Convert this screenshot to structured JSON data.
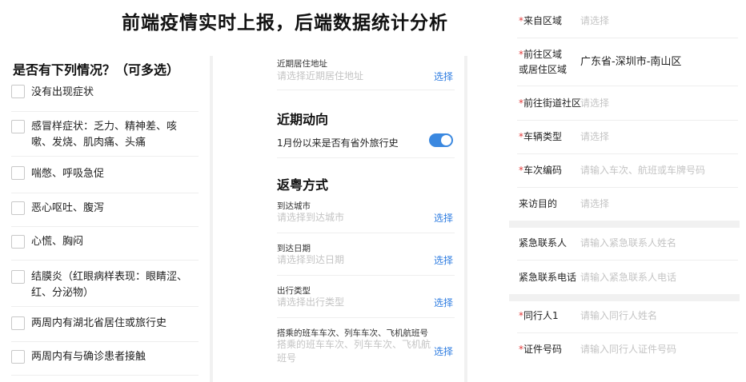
{
  "page_title": "前端疫情实时上报，后端数据统计分析",
  "symptoms": {
    "heading": "是否有下列情况？（可多选）",
    "options": [
      {
        "label": "没有出现症状",
        "checked": false
      },
      {
        "label": "感冒样症状：乏力、精神差、咳嗽、发烧、肌肉痛、头痛",
        "checked": false
      },
      {
        "label": "喘憋、呼吸急促",
        "checked": false
      },
      {
        "label": "恶心呕吐、腹泻",
        "checked": false
      },
      {
        "label": "心慌、胸闷",
        "checked": false
      },
      {
        "label": "结膜炎（红眼病样表现：眼睛涩、红、分泌物）",
        "checked": false
      },
      {
        "label": "两周内有湖北省居住或旅行史",
        "checked": false
      },
      {
        "label": "两周内有与确诊患者接触",
        "checked": false
      }
    ]
  },
  "travel": {
    "address": {
      "label": "近期居住地址",
      "placeholder": "请选择近期居住地址",
      "action": "选择"
    },
    "recent_heading": "近期动向",
    "outside_question": "1月份以来是否有省外旅行史",
    "outside_toggle_on": true,
    "return_heading": "返粤方式",
    "fields": [
      {
        "label": "到达城市",
        "placeholder": "请选择到达城市",
        "action": "选择"
      },
      {
        "label": "到达日期",
        "placeholder": "请选择到达日期",
        "action": "选择"
      },
      {
        "label": "出行类型",
        "placeholder": "请选择出行类型",
        "action": "选择"
      },
      {
        "label": "搭乘的班车车次、列车车次、飞机航班号",
        "placeholder_line1": "搭乘的班车车次、列车车次、飞机航",
        "placeholder_line2": "班号",
        "action": "选择"
      }
    ]
  },
  "personal": {
    "from_area": {
      "required": "*",
      "label": "来自区域",
      "placeholder": "请选择"
    },
    "dest_area": {
      "required": "*",
      "label_line1": "前往区域",
      "label_line2": "或居住区域",
      "value": "广东省-深圳市-南山区"
    },
    "dest_street": {
      "required": "*",
      "label": "前往街道社区",
      "placeholder": "请选择"
    },
    "vehicle_type": {
      "required": "*",
      "label": "车辆类型",
      "placeholder": "请选择"
    },
    "vehicle_code": {
      "required": "*",
      "label": "车次编码",
      "placeholder": "请输入车次、航班或车牌号码"
    },
    "visit_purpose": {
      "label": "来访目的",
      "placeholder": "请选择"
    },
    "emergency_name": {
      "label": "紧急联系人",
      "placeholder": "请输入紧急联系人姓名"
    },
    "emergency_phone": {
      "label": "紧急联系电话",
      "placeholder": "请输入紧急联系人电话"
    },
    "companion": {
      "required": "*",
      "label": "同行人1",
      "placeholder": "请输入同行人姓名"
    },
    "id_number": {
      "required": "*",
      "label": "证件号码",
      "placeholder": "请输入同行人证件号码"
    }
  },
  "colors": {
    "accent": "#2f7de1",
    "required": "#e23a3a",
    "toggle_on": "#3a88e0",
    "placeholder": "#c4c4c4"
  }
}
